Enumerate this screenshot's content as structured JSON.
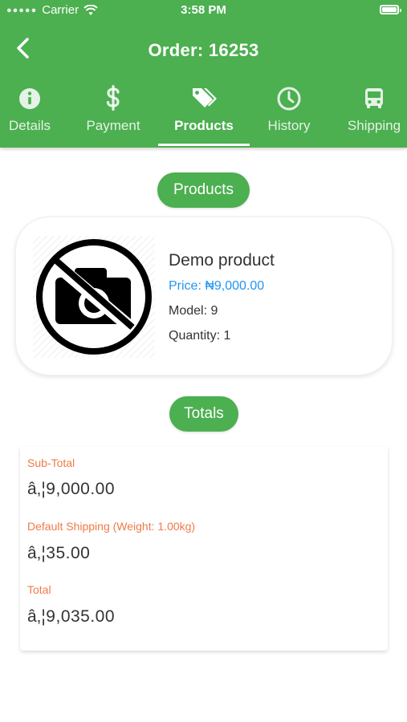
{
  "status_bar": {
    "carrier": "Carrier",
    "time": "3:58 PM"
  },
  "header": {
    "title": "Order: 16253"
  },
  "tabs": [
    {
      "label": "Details",
      "icon": "info-icon"
    },
    {
      "label": "Payment",
      "icon": "dollar-icon"
    },
    {
      "label": "Products",
      "icon": "tags-icon",
      "active": true
    },
    {
      "label": "History",
      "icon": "clock-icon"
    },
    {
      "label": "Shipping",
      "icon": "bus-icon"
    }
  ],
  "products_section": {
    "label": "Products"
  },
  "product": {
    "name": "Demo product",
    "price": "Price: ₦9,000.00",
    "model": "Model: 9",
    "quantity": "Quantity: 1",
    "image_icon": "no-camera-icon"
  },
  "totals_section": {
    "label": "Totals"
  },
  "totals": [
    {
      "label": "Sub-Total",
      "value": "â‚¦9,000.00"
    },
    {
      "label": "Default Shipping  (Weight: 1.00kg)",
      "value": "â‚¦35.00"
    },
    {
      "label": "Total",
      "value": "â‚¦9,035.00"
    }
  ],
  "colors": {
    "primary": "#4caf50",
    "price": "#2196f3",
    "total_label": "#f07a4a"
  }
}
